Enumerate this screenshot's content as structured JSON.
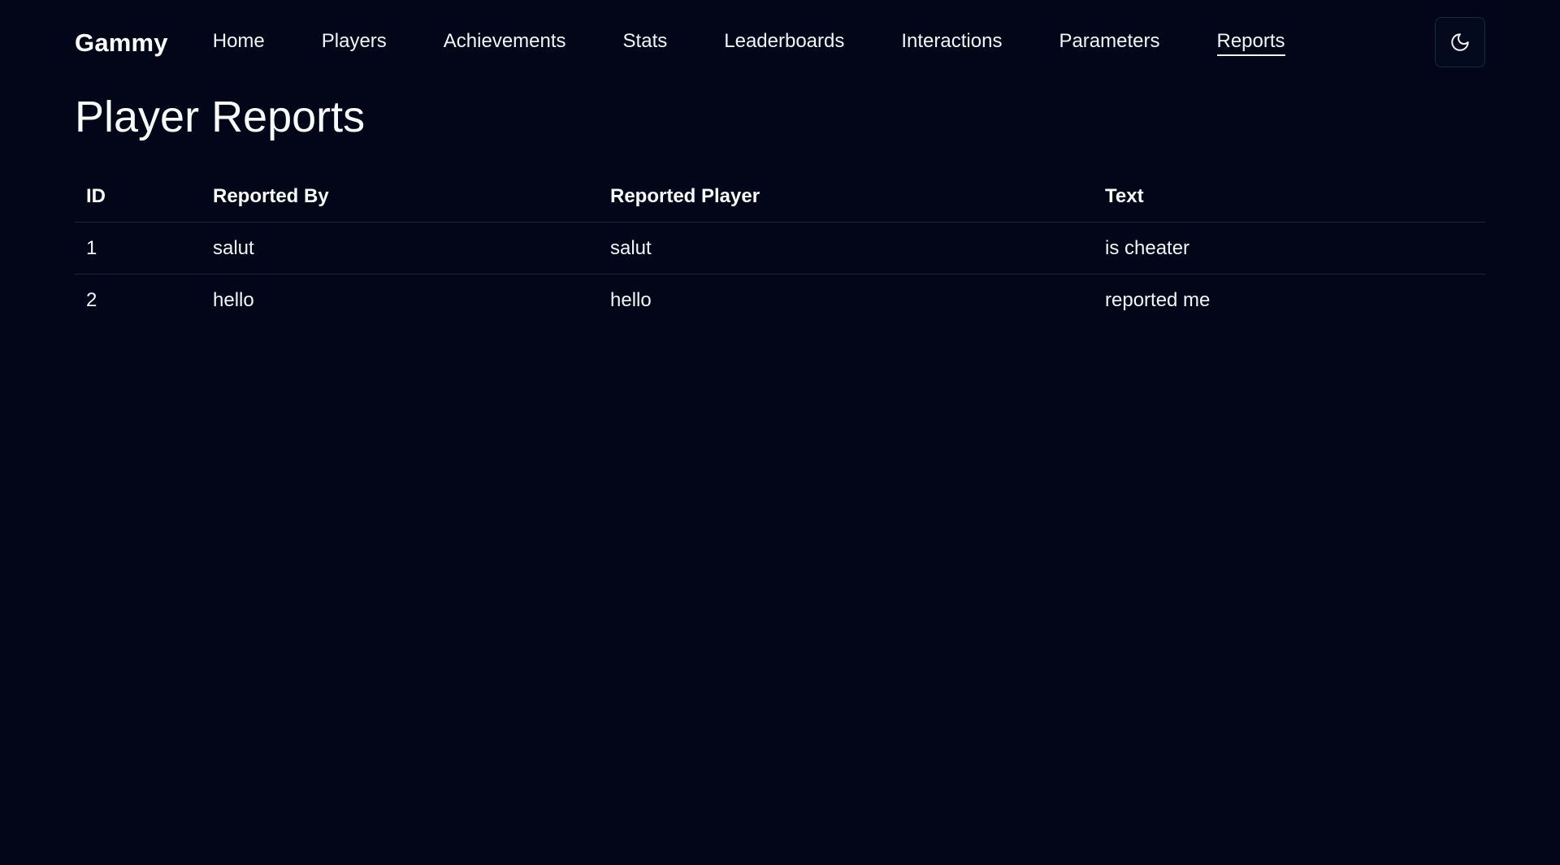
{
  "nav": {
    "brand": "Gammy",
    "links": [
      "Home",
      "Players",
      "Achievements",
      "Stats",
      "Leaderboards",
      "Interactions",
      "Parameters",
      "Reports"
    ],
    "active": "Reports",
    "theme_toggle_icon": "moon-icon"
  },
  "page": {
    "title": "Player Reports"
  },
  "table": {
    "columns": [
      "ID",
      "Reported By",
      "Reported Player",
      "Text"
    ],
    "rows": [
      [
        "1",
        "salut",
        "salut",
        "is cheater"
      ],
      [
        "2",
        "hello",
        "hello",
        "reported me"
      ]
    ]
  },
  "colors": {
    "background": "#020618",
    "text": "#f8fafc",
    "divider": "#1e2536"
  }
}
